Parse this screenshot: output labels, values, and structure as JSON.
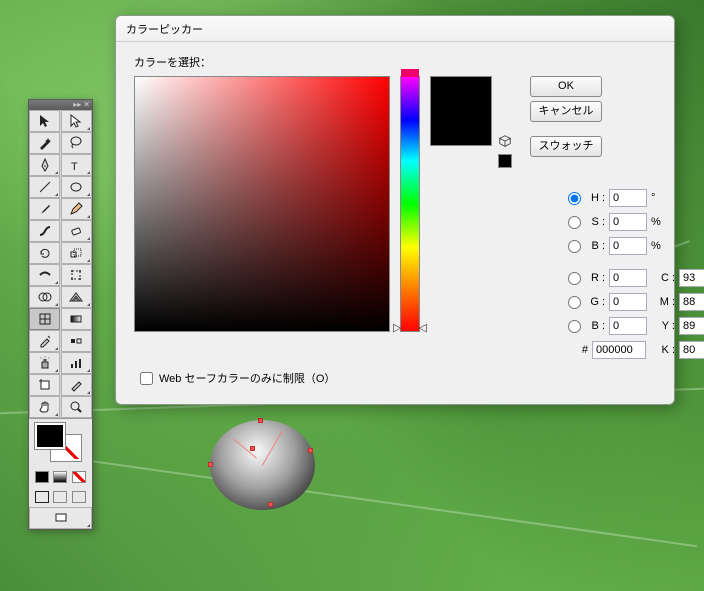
{
  "dialog": {
    "title": "カラーピッカー",
    "select_label": "カラーを選択：",
    "ok": "OK",
    "cancel": "キャンセル",
    "swatches": "スウォッチ",
    "websafe": "Web セーフカラーのみに制限（O）"
  },
  "hsb": {
    "h": {
      "label": "H :",
      "value": "0",
      "unit": "°",
      "checked": true
    },
    "s": {
      "label": "S :",
      "value": "0",
      "unit": "%",
      "checked": false
    },
    "b": {
      "label": "B :",
      "value": "0",
      "unit": "%",
      "checked": false
    }
  },
  "rgb": {
    "r": {
      "label": "R :",
      "value": "0"
    },
    "g": {
      "label": "G :",
      "value": "0"
    },
    "b": {
      "label": "B :",
      "value": "0"
    }
  },
  "cmyk": {
    "c": {
      "label": "C :",
      "value": "93",
      "unit": "%"
    },
    "m": {
      "label": "M :",
      "value": "88",
      "unit": "%"
    },
    "y": {
      "label": "Y :",
      "value": "89",
      "unit": "%"
    },
    "k": {
      "label": "K :",
      "value": "80",
      "unit": "%"
    }
  },
  "hex": {
    "label": "#",
    "value": "000000"
  },
  "colors": {
    "preview": "#000000",
    "fg": "#000000",
    "bg": "#ffffff"
  }
}
